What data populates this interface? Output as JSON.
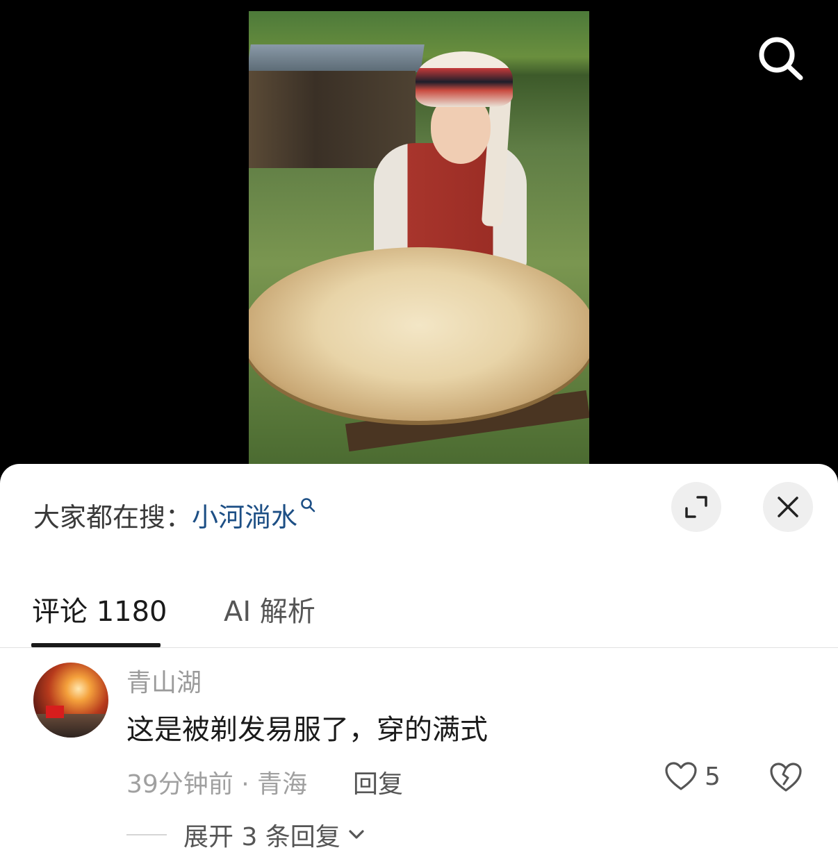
{
  "hot_search": {
    "prefix": "大家都在搜：",
    "term": "小河淌水"
  },
  "tabs": [
    {
      "label": "评论 1180"
    },
    {
      "label": "AI 解析"
    }
  ],
  "comment": {
    "username": "青山湖",
    "text": "这是被剃发易服了，穿的满式",
    "meta": "39分钟前 · 青海",
    "reply_label": "回复",
    "like_count": "5",
    "expand_label": "展开 3 条回复"
  },
  "colors": {
    "link": "#1d4f85",
    "muted": "#a0a0a0",
    "sheet_bg": "#ffffff",
    "page_bg": "#000000"
  }
}
